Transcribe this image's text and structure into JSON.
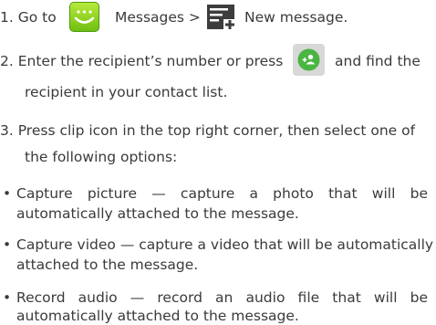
{
  "steps": [
    {
      "num": "1.",
      "a": "Go to",
      "b": "Messages  >",
      "c": "New message.",
      "icons": [
        "messaging-icon",
        "new-message-icon"
      ]
    },
    {
      "num": "2.",
      "line1a": "Enter the recipient’s number or press",
      "line1b": "and find the",
      "line2": "recipient in your contact list.",
      "icon": "add-contact-icon"
    },
    {
      "num": "3.",
      "line1": "Press clip icon in the top right corner, then select one of",
      "line2": "the following options:"
    }
  ],
  "options": [
    {
      "bullet": "•",
      "line1": "Capture picture — capture a photo that will be",
      "line2": "automatically attached to the message."
    },
    {
      "bullet": "•",
      "line1": "Capture video — capture a video that will be automatically",
      "line2": "attached to the message."
    },
    {
      "bullet": "•",
      "line1": "Record audio — record an audio file that will be",
      "line2": "automatically attached to the message."
    }
  ],
  "colors": {
    "text": "#3a3a3a",
    "icon_green": "#7fca1d",
    "icon_dark": "#3d3d3d",
    "contact_green": "#4bb543"
  }
}
